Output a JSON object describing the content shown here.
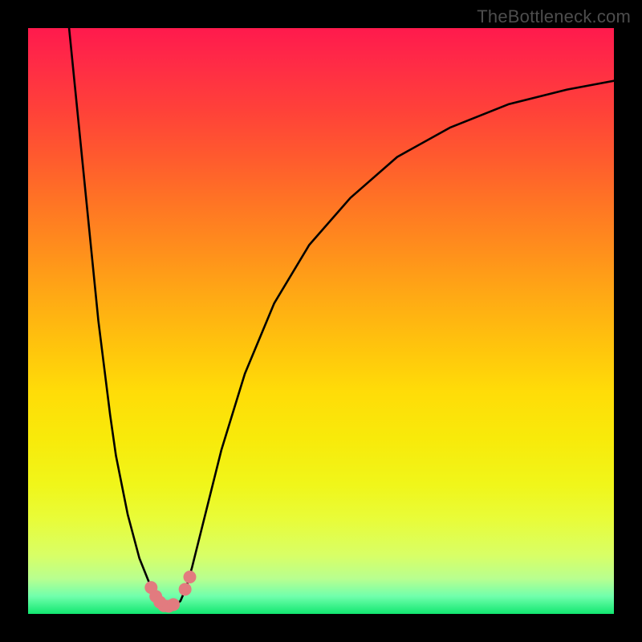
{
  "watermark": "TheBottleneck.com",
  "chart_data": {
    "type": "line",
    "title": "",
    "xlabel": "",
    "ylabel": "",
    "xlim": [
      0,
      100
    ],
    "ylim": [
      0,
      100
    ],
    "grid": false,
    "series": [
      {
        "name": "bottleneck-curve",
        "x": [
          7,
          8,
          9,
          10,
          11,
          12,
          13,
          14,
          15,
          17,
          19,
          21,
          22.5,
          24,
          25,
          26,
          27,
          28,
          30,
          33,
          37,
          42,
          48,
          55,
          63,
          72,
          82,
          92,
          100
        ],
        "values": [
          100,
          90,
          80,
          70,
          60,
          50,
          42,
          34,
          27,
          17,
          9.5,
          4.5,
          2.2,
          1.4,
          1.4,
          2.2,
          4.5,
          8,
          16,
          28,
          41,
          53,
          63,
          71,
          78,
          83,
          87,
          89.5,
          91
        ]
      }
    ],
    "markers": {
      "name": "highlight-dots",
      "color": "#e27b7f",
      "points": [
        {
          "x": 21.0,
          "y": 4.5
        },
        {
          "x": 21.8,
          "y": 3.0
        },
        {
          "x": 22.5,
          "y": 2.0
        },
        {
          "x": 23.2,
          "y": 1.4
        },
        {
          "x": 24.0,
          "y": 1.3
        },
        {
          "x": 24.8,
          "y": 1.6
        },
        {
          "x": 26.8,
          "y": 4.2
        },
        {
          "x": 27.6,
          "y": 6.3
        }
      ]
    },
    "background_gradient": {
      "top": "#ff1a4d",
      "mid": "#ffd000",
      "bottom": "#12e770"
    }
  }
}
